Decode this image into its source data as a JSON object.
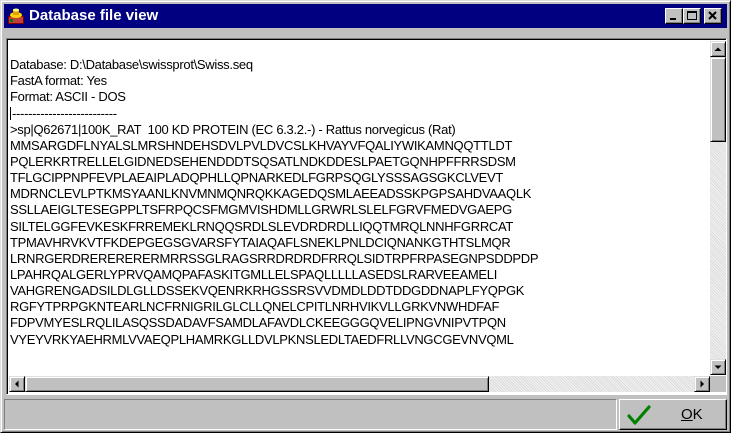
{
  "window": {
    "title": "Database file view",
    "icon": "database-app-icon",
    "controls": [
      "minimize-icon",
      "maximize-icon",
      "close-icon"
    ]
  },
  "content": {
    "lines": [
      "Database: D:\\Database\\swissprot\\Swiss.seq",
      "FastA format: Yes",
      "Format: ASCII - DOS",
      "--------------------------",
      ">sp|Q62671|100K_RAT  100 KD PROTEIN (EC 6.3.2.-) - Rattus norvegicus (Rat)",
      "MMSARGDFLNYALSLMRSHNDEHSDVLPVLDVCSLKHVAYVFQALIYWIKAMNQQTTLDT",
      "PQLERKRTRELLELGIDNEDSEHENDDDTSQSATLNDKDDESLPAETGQNHPFFRRSDSM",
      "TFLGCIPPNPFEVPLAEAIPLADQPHLLQPNARKEDLFGRPSQGLYSSSAGSGKCLVEVT",
      "MDRNCLEVLPTKMSYAANLKNVMNMQNRQKKAGEDQSMLAEEADSSKPGPSAHDVAAQLK",
      "SSLLAEIGLTESEGPPLTSFRPQCSFMGMVISHDMLLGRWRLSLELFGRVFMEDVGAEPG",
      "SILTELGGFEVKESKFRREMEKLRNQQSRDLSLEVDRDRDLLIQQTMRQLNNHFGRRCAT",
      "TPMAVHRVKVTFKDEPGEGSGVARSFYTAIAQAFLSNEKLPNLDCIQNANKGTHTSLMQR",
      "LRNRGERDRERERERERMRRSSGLRAGSRRDRDRDFRRQLSIDTRPFRPASEGNPSDDPDP",
      "LPAHRQALGERLYPRVQAMQPAFASKITGMLLELSPAQLLLLLASEDSLRARVEEAMELI",
      "VAHGRENGADSILDLGLLDSSEKVQENRKRHGSSRSVVDMDLDDTDDGDDNAPLFYQPGK",
      "RGFYTPRPGKNTEARLNCFRNIGRILGLCLLQNELCPITLNRHVIKVLLGRKVNWHDFAF",
      "FDPVMYESLRQLILASQSSDADAVFSAMDLAFAVDLCKEEGGGQVELIPNGVNIPVTPQN",
      "VYEYVRKYAEHRMLVVAEQPLHAMRKGLLDVLPKNSLEDLTAEDFRLLVNGCGEVNVQML"
    ]
  },
  "vertical_scroll_position": 0,
  "horizontal_scroll_position": 0,
  "ok_button": {
    "label_prefix": "",
    "label_underlined": "O",
    "label_rest": "K",
    "icon": "checkmark-icon"
  }
}
